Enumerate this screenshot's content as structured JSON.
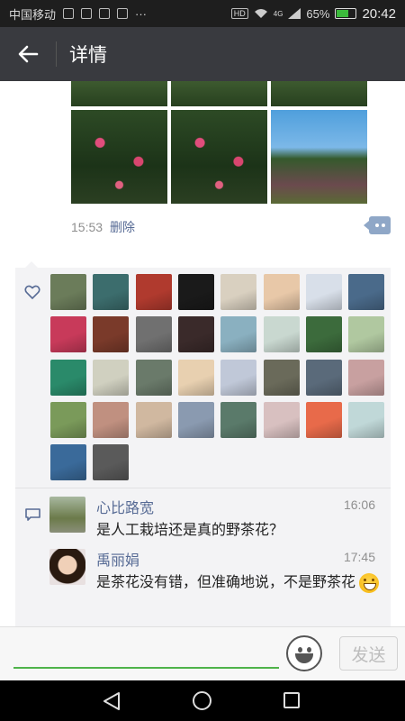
{
  "status_bar": {
    "carrier": "中国移动",
    "extra": "···",
    "hd": "HD",
    "network": "4G",
    "battery": "65%",
    "battery_level": 0.65,
    "time": "20:42"
  },
  "header": {
    "back_icon": "arrow-left-icon",
    "title": "详情"
  },
  "post": {
    "time": "15:53",
    "delete_label": "删除",
    "photos": [
      "strip",
      "strip",
      "strip",
      "flower",
      "flower",
      "sky"
    ]
  },
  "likes": {
    "icon": "heart-outline-icon",
    "count": 34,
    "avatar_colors": [
      "#6b7c5a",
      "#3c6d6d",
      "#b03a2e",
      "#1a1a1a",
      "#d9d0c0",
      "#e8c8a8",
      "#d8dfe9",
      "#4a6a8a",
      "#c83a5a",
      "#7a3a2a",
      "#707070",
      "#3a2a2a",
      "#8ab0c0",
      "#c9d8d0",
      "#3c6b3c",
      "#b0c8a0",
      "#2a8a6a",
      "#d0d0c0",
      "#6a7a6a",
      "#e8d0b0",
      "#c0c8d8",
      "#6a6a5a",
      "#5a6a7a",
      "#c8a0a0",
      "#7a9a5a",
      "#c09080",
      "#d0b8a0",
      "#8a9ab0",
      "#5a7a6a",
      "#d8c0c0",
      "#e86a4a",
      "#c0d8d8",
      "#3a6a9a",
      "#5a5a5a"
    ]
  },
  "comments": {
    "icon": "speech-bubble-icon",
    "items": [
      {
        "name": "心比路宽",
        "time": "16:06",
        "text": "是人工栽培还是真的野茶花？",
        "avatar_color": "#7a8a5a"
      },
      {
        "name": "禹丽娟",
        "time": "17:45",
        "text": "是茶花没有错，但准确地说，不是野茶花",
        "avatar_color": "#4a2a1a"
      }
    ]
  },
  "input_bar": {
    "placeholder": "",
    "emoji_icon": "emoji-face-icon",
    "send_label": "发送"
  },
  "nav_bar": {
    "back_icon": "triangle-back-icon",
    "home_icon": "circle-home-icon",
    "recent_icon": "square-recent-icon"
  }
}
